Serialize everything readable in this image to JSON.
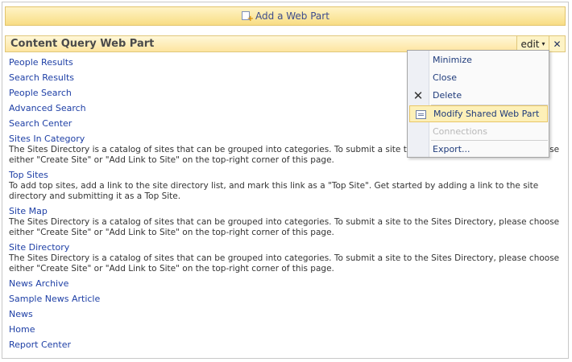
{
  "toolbar": {
    "add_web_part": "Add a Web Part"
  },
  "webpart": {
    "title": "Content Query Web Part",
    "edit_label": "edit",
    "caret": "▾",
    "close_glyph": "✕"
  },
  "menu": {
    "items": [
      {
        "label": "Minimize",
        "icon": ""
      },
      {
        "label": "Close",
        "icon": ""
      },
      {
        "label": "Delete",
        "icon": "delete-x-icon"
      },
      {
        "label": "Modify Shared Web Part",
        "icon": "modify-web-part-icon"
      },
      {
        "label": "Connections",
        "icon": ""
      },
      {
        "label": "Export...",
        "icon": ""
      }
    ]
  },
  "links": [
    {
      "title": "People Results"
    },
    {
      "title": "Search Results"
    },
    {
      "title": "People Search"
    },
    {
      "title": "Advanced Search"
    },
    {
      "title": "Search Center"
    },
    {
      "title": "Sites In Category",
      "desc": "The Sites Directory is a catalog of sites that can be grouped into categories. To submit a site to the Sites Directory, please choose either \"Create Site\" or \"Add Link to Site\" on the top-right corner of this page."
    },
    {
      "title": "Top Sites",
      "desc": "To add top sites, add a link to the site directory list, and mark this link as a \"Top Site\". Get started by adding a link to the site directory and submitting it as a Top Site."
    },
    {
      "title": "Site Map",
      "desc": "The Sites Directory is a catalog of sites that can be grouped into categories. To submit a site to the Sites Directory, please choose either \"Create Site\" or \"Add Link to Site\" on the top-right corner of this page."
    },
    {
      "title": "Site Directory",
      "desc": "The Sites Directory is a catalog of sites that can be grouped into categories. To submit a site to the Sites Directory, please choose either \"Create Site\" or \"Add Link to Site\" on the top-right corner of this page."
    },
    {
      "title": "News Archive"
    },
    {
      "title": "Sample News Article"
    },
    {
      "title": "News"
    },
    {
      "title": "Home"
    },
    {
      "title": "Report Center"
    }
  ]
}
